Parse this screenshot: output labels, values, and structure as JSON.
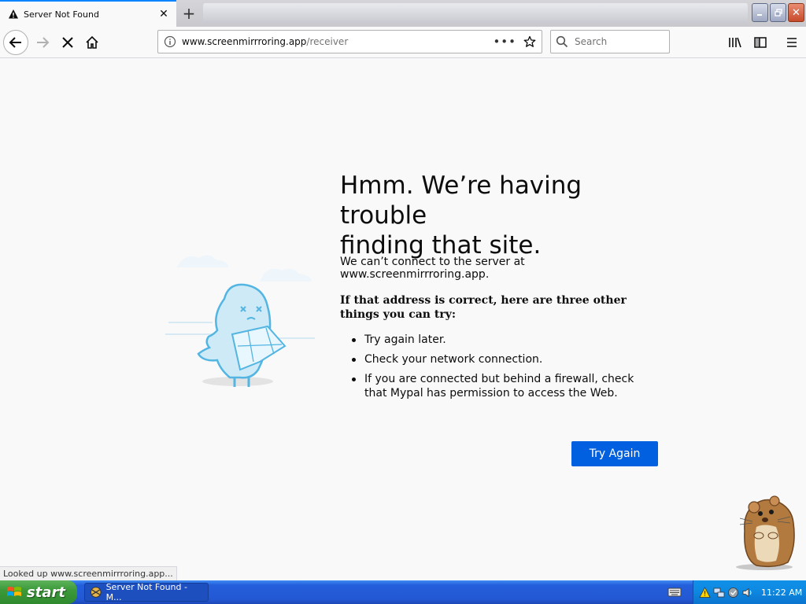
{
  "browser": {
    "tab": {
      "title": "Server Not Found"
    },
    "url": {
      "host": "www.screenmirrroring.app",
      "path": "/receiver"
    },
    "search": {
      "placeholder": "Search"
    },
    "status": "Looked up www.screenmirrroring.app..."
  },
  "error_page": {
    "title_line1": "Hmm. We’re having trouble",
    "title_line2": "finding that site.",
    "description": "We can’t connect to the server at www.screenmirrroring.app.",
    "subtitle": "If that address is correct, here are three other things you can try:",
    "suggestions": [
      "Try again later.",
      "Check your network connection.",
      "If you are connected but behind a firewall, check that Mypal has permission to access the Web."
    ],
    "button_label": "Try Again"
  },
  "taskbar": {
    "start_label": "start",
    "task_label": "Server Not Found - M...",
    "clock": "11:22 AM"
  },
  "colors": {
    "accent": "#0060df",
    "tab_highlight": "#0a84ff",
    "taskbar_blue": "#245edb",
    "start_green": "#3c9a3a"
  }
}
